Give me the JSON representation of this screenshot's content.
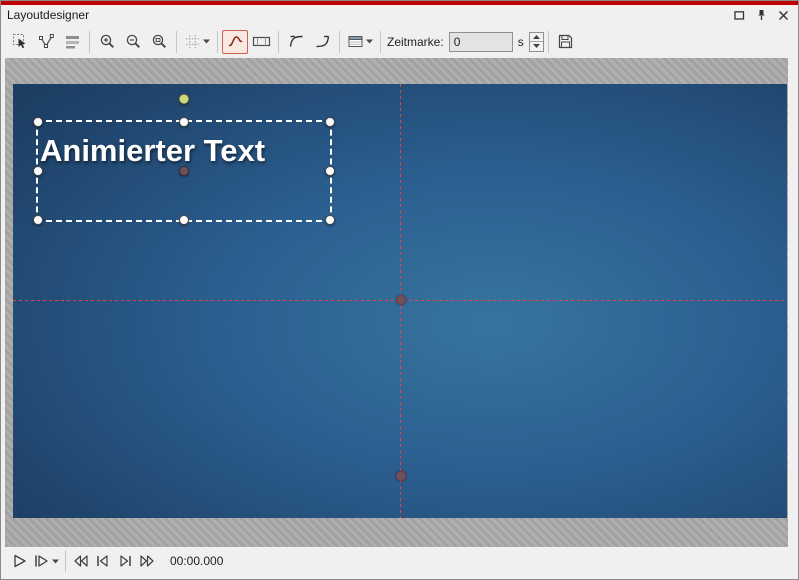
{
  "window": {
    "title": "Layoutdesigner"
  },
  "toolbar": {
    "zeitmarke_label": "Zeitmarke:",
    "zeitmarke_value": "0",
    "unit": "s",
    "icons": [
      "select-tool-icon",
      "curve-nodes-icon",
      "tracks-icon",
      "zoom-in-icon",
      "zoom-out-icon",
      "zoom-fit-icon",
      "grid-icon",
      "motion-path-icon",
      "camera-frame-icon",
      "ease-out-icon",
      "ease-in-icon",
      "object-list-icon",
      "save-icon"
    ]
  },
  "canvas": {
    "text": "Animierter Text"
  },
  "playback": {
    "time": "00:00.000"
  },
  "colors": {
    "accent_red": "#c00000",
    "guide_red": "#e04545",
    "selection_white": "#ffffff",
    "canvas_center_blue": "#38749f",
    "canvas_edge_blue": "#152d4c",
    "rotation_handle_green": "#ccd977"
  }
}
